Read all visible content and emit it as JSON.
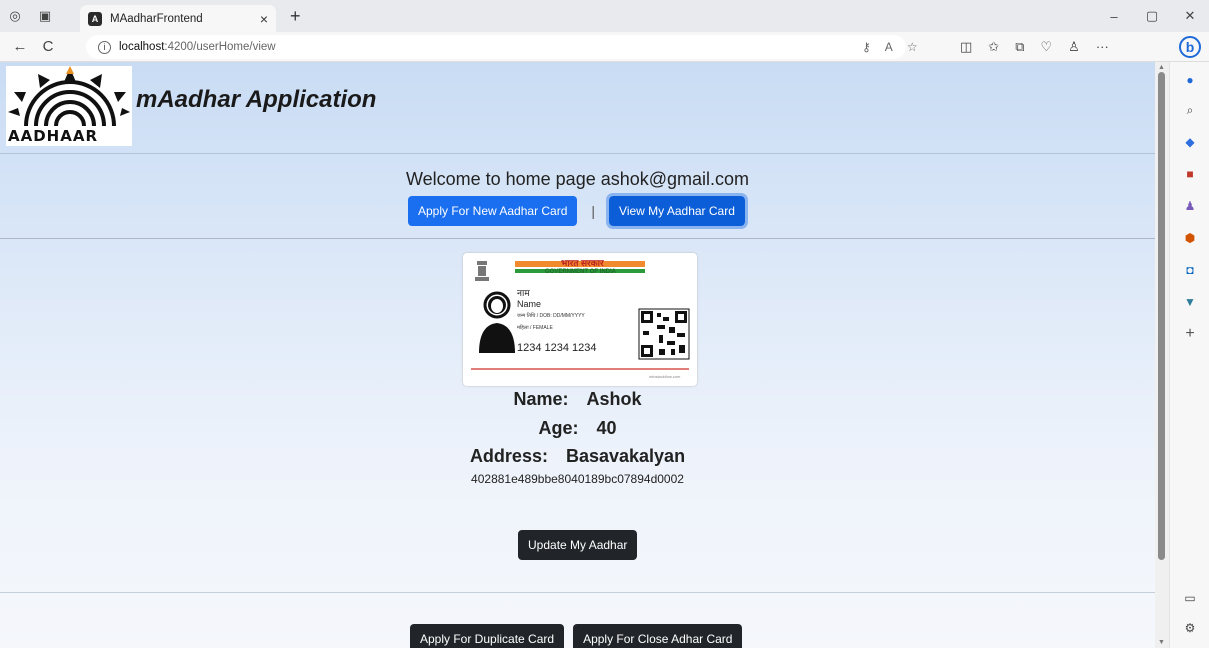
{
  "browser": {
    "tab_title": "MAadharFrontend",
    "favicon_letter": "A",
    "url_host": "localhost",
    "url_path": ":4200/userHome/view",
    "new_tab_glyph": "+",
    "close_tab_glyph": "×",
    "back_glyph": "←",
    "refresh_glyph": "C",
    "minimize_glyph": "–",
    "maximize_glyph": "▢",
    "close_glyph": "✕",
    "more_glyph": "···",
    "bing_letter": "b"
  },
  "page": {
    "logo_word": "AADHAAR",
    "app_title": "mAadhar Application",
    "welcome_text": "Welcome to home page ashok@gmail.com",
    "apply_new_label": "Apply For New Aadhar Card",
    "separator": "|",
    "view_label": "View My Aadhar Card",
    "card": {
      "hindi_gov": "भारत सरकार",
      "gov_label": "GOVERNMENT OF INDIA",
      "hindi_name": "नाम",
      "name_placeholder": "Name",
      "dob_line": "जन्म तिथि / DOB: DD/MM/YYYY",
      "gender_line": "महिला / FEMALE",
      "number": "1234 1234 1234",
      "footer": "infostackflow.com"
    },
    "name_label": "Name:",
    "name_value": "Ashok",
    "age_label": "Age:",
    "age_value": "40",
    "address_label": "Address:",
    "address_value": "Basavakalyan",
    "aadhar_id": "402881e489bbe8040189bc07894d0002",
    "update_label": "Update My Aadhar",
    "duplicate_label": "Apply For Duplicate Card",
    "close_card_label": "Apply For Close Adhar Card"
  },
  "colors": {
    "primary_blue": "#1a6ff0",
    "dark_button": "#212529",
    "page_gradient_top": "#c9dcf4"
  },
  "sidebar_icons": [
    "bell-icon",
    "search-icon",
    "tag-icon",
    "briefcase-icon",
    "games-icon",
    "office-icon",
    "outlook-icon",
    "drop-icon",
    "add-icon",
    "split-screen-icon",
    "settings-icon"
  ]
}
